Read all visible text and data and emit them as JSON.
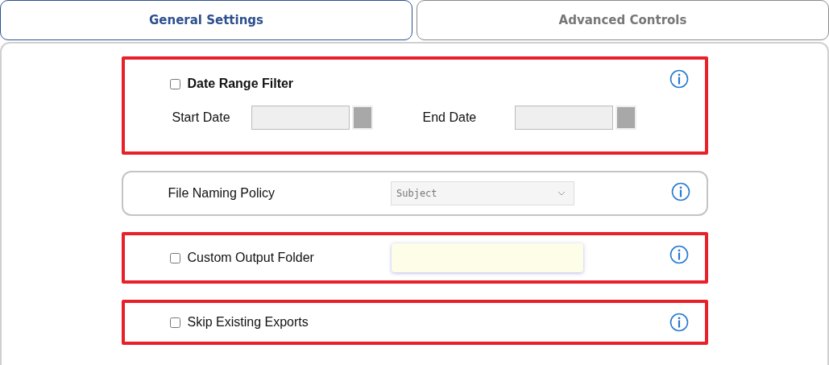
{
  "tabs": [
    {
      "label": "General Settings",
      "selected": true
    },
    {
      "label": "Advanced Controls",
      "selected": false
    }
  ],
  "sections": [
    {
      "kind": "date",
      "highlighted": true,
      "label": "Date Range Filter",
      "checked": false,
      "start_label": "Start Date",
      "end_label": "End Date"
    },
    {
      "kind": "select",
      "highlighted": false,
      "label": "File Naming Policy",
      "value": "Subject"
    },
    {
      "kind": "folder",
      "highlighted": true,
      "label": "Custom Output Folder",
      "checked": false
    },
    {
      "kind": "checkbox",
      "highlighted": true,
      "label": "Skip Existing Exports",
      "checked": false
    }
  ]
}
